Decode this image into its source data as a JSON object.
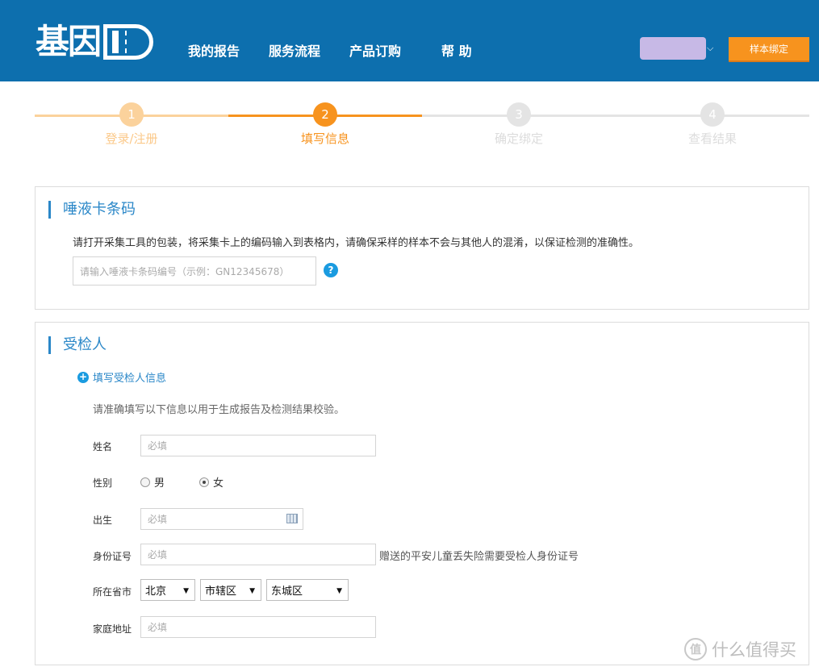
{
  "header": {
    "logo_text": "基因",
    "nav": [
      "我的报告",
      "服务流程",
      "产品订购",
      "帮 助"
    ],
    "bind_button": "样本绑定",
    "accent": "#0d6fae",
    "button_color": "#f7931e"
  },
  "stepper": {
    "steps": [
      {
        "num": "1",
        "label": "登录/注册",
        "state": "done"
      },
      {
        "num": "2",
        "label": "填写信息",
        "state": "active"
      },
      {
        "num": "3",
        "label": "确定绑定",
        "state": "pending"
      },
      {
        "num": "4",
        "label": "查看结果",
        "state": "pending"
      }
    ]
  },
  "saliva": {
    "title": "唾液卡条码",
    "desc": "请打开采集工具的包装，将采集卡上的编码输入到表格内，请确保采样的样本不会与其他人的混淆，以保证检测的准确性。",
    "placeholder": "请输入唾液卡条码编号（示例：GN12345678）",
    "help_icon": "?"
  },
  "subject": {
    "title": "受检人",
    "add_link": "填写受检人信息",
    "desc": "请准确填写以下信息以用于生成报告及检测结果校验。",
    "fields": {
      "name_label": "姓名",
      "name_placeholder": "必填",
      "gender_label": "性别",
      "gender_male": "男",
      "gender_female": "女",
      "gender_selected": "女",
      "birth_label": "出生",
      "birth_placeholder": "必填",
      "id_label": "身份证号",
      "id_placeholder": "必填",
      "id_hint": "赠送的平安儿童丢失险需要受检人身份证号",
      "region_label": "所在省市",
      "province": "北京",
      "city": "市辖区",
      "district": "东城区",
      "address_label": "家庭地址",
      "address_placeholder": "必填"
    }
  },
  "watermark": "什么值得买"
}
